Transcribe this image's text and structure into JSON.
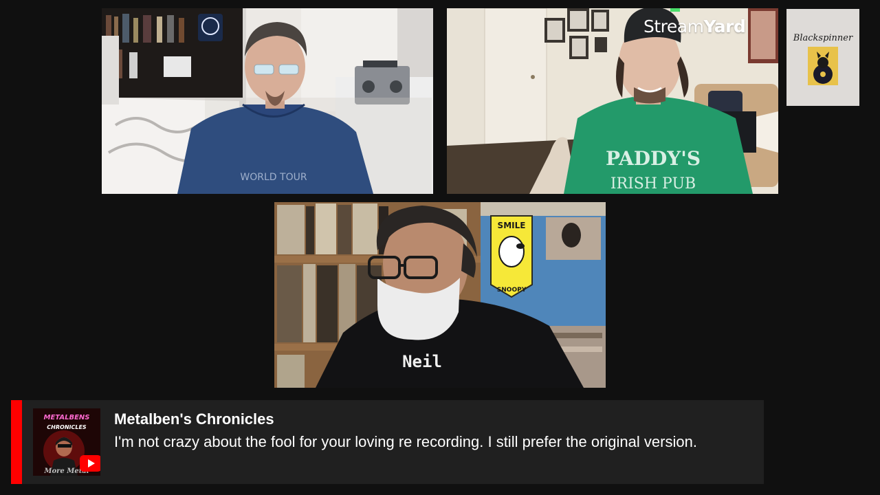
{
  "layout": {
    "background_color": "#101010"
  },
  "participants": [
    {
      "tile": "top-left",
      "scene": "man with glasses and goatee in blue t-shirt, bedroom with bookshelf and boombox",
      "shirt_text": "WORLD TOUR"
    },
    {
      "tile": "top-right",
      "scene": "smiling man in cap and green t-shirt, room with framed pictures",
      "shirt_text_line1": "PADDY'S",
      "shirt_text_line2": "IRISH PUB"
    },
    {
      "tile": "bottom-center",
      "scene": "man with glasses and white beard in black t-shirt, record shelves and Snoopy pennant",
      "shirt_text": "Neil",
      "pennant_top": "SMILE",
      "pennant_bottom": "SNOOPY"
    }
  ],
  "overlay": {
    "brand_part1": "Stream",
    "brand_part2": "Yard",
    "side_thumbnail": {
      "signature_text": "Blackspinner",
      "icon": "vinyl-cat-logo"
    }
  },
  "comment": {
    "author": "Metalben's Chronicles",
    "message": "I'm not crazy about the fool for your loving re recording. I still prefer the original version.",
    "accent_color": "#ff0000",
    "avatar": {
      "title_line1": "METALBENS",
      "title_line2": "CHRONICLES",
      "tagline": "More Metal",
      "icon": "youtube-icon"
    }
  }
}
